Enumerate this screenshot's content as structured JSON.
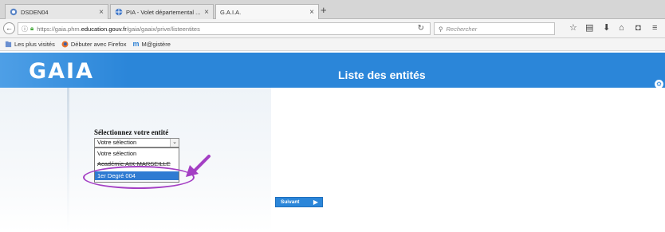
{
  "browser": {
    "tabs": [
      {
        "label": "DSDEN04",
        "active": false,
        "icon": "site-icon"
      },
      {
        "label": "PIA - Volet départemental ...",
        "active": false,
        "icon": "globe-icon"
      },
      {
        "label": "G.A.I.A.",
        "active": true,
        "icon": ""
      }
    ],
    "new_tab_label": "+",
    "url": {
      "scheme": "https://gaia.phm.",
      "host": "education.gouv.fr",
      "path": "/gaia/gaaix/prive/listeentites"
    },
    "search_placeholder": "Rechercher",
    "bookmarks": [
      {
        "label": "Les plus visités",
        "icon": "bookmark-folder-icon"
      },
      {
        "label": "Débuter avec Firefox",
        "icon": "firefox-icon"
      },
      {
        "label": "M@gistère",
        "icon": "m-logo-icon"
      }
    ]
  },
  "app": {
    "logo": "GAIA",
    "page_title": "Liste des entités",
    "form": {
      "label": "Sélectionnez votre entité",
      "selected_value": "Votre sélection",
      "options": [
        "Votre sélection",
        "Académie AIX-MARSEILLE",
        "1er Degré 004"
      ],
      "highlighted_option": "1er Degré 004"
    },
    "next_button_label": "Suivant"
  },
  "colors": {
    "banner": "#2b86d9",
    "annotation": "#a43fc4",
    "selection": "#2f7bd2"
  }
}
